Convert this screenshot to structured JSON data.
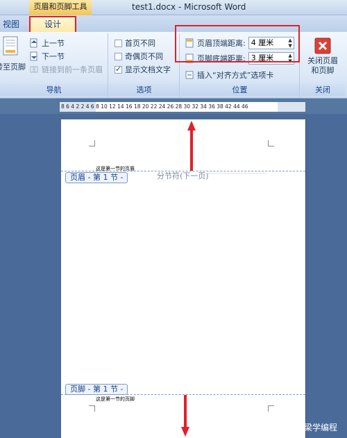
{
  "title_bar": {
    "context_tab": "页眉和页脚工具",
    "document_title": "test1.docx - Microsoft Word"
  },
  "tabs": {
    "view": "视图",
    "design": "设计"
  },
  "ribbon": {
    "navigation": {
      "goto_footer": "转至页脚",
      "previous_section": "上一节",
      "next_section": "下一节",
      "link_to_previous": "链接到前一条页眉",
      "label": "导航"
    },
    "options": {
      "different_first_page": "首页不同",
      "different_odd_even": "奇偶页不同",
      "show_document_text": "显示文档文字",
      "show_document_text_checked": true,
      "label": "选项"
    },
    "position": {
      "header_from_top_label": "页眉顶端距离:",
      "header_from_top_value": "4 厘米",
      "footer_from_bottom_label": "页脚底端距离:",
      "footer_from_bottom_value": "3 厘米",
      "insert_alignment_tab": "插入“对齐方式”选项卡",
      "label": "位置"
    },
    "close": {
      "close_header_footer": "关闭页眉和页脚",
      "label": "关闭"
    }
  },
  "ruler": {
    "ticks": "8  6  4  2     2  4  6  8  10 12 14 16 18 20 22 24 26 28 30 32 34 36 38    42 44 46"
  },
  "page": {
    "header_tag": "页眉 - 第 1 节 -",
    "footer_tag": "页脚 - 第 1 节 -",
    "section_break": "分节符(下一页)",
    "header_text": "这是第一节的页眉",
    "footer_text": "这是第一节的页脚"
  },
  "watermark": "梁学编程",
  "colors": {
    "highlight_red": "#e0202a",
    "ribbon_blue": "#15428b"
  }
}
